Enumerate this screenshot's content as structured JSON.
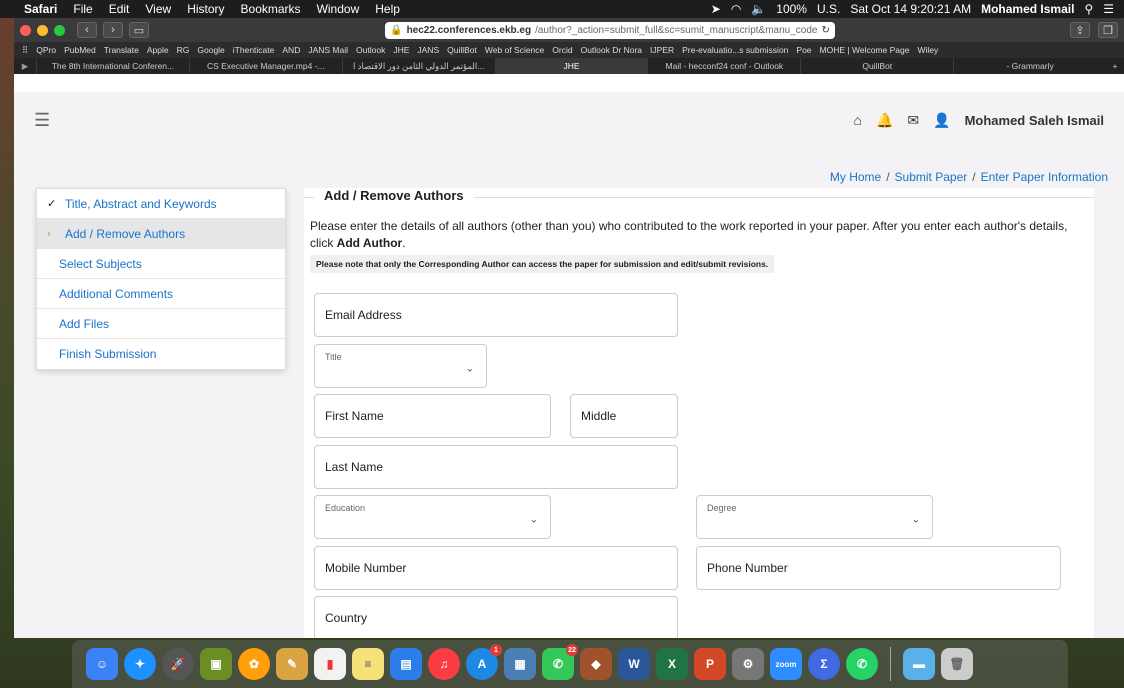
{
  "menubar": {
    "app": "Safari",
    "items": [
      "File",
      "Edit",
      "View",
      "History",
      "Bookmarks",
      "Window",
      "Help"
    ],
    "battery": "100%",
    "input_source": "U.S.",
    "datetime": "Sat Oct 14  9:20:21 AM",
    "user": "Mohamed Ismail"
  },
  "browser": {
    "url_host": "hec22.conferences.ekb.eg",
    "url_path": "/author?_action=submit_full&sc=sumit_manuscript&manu_code",
    "bookmarks": [
      "QPro",
      "PubMed",
      "Translate",
      "Apple",
      "RG",
      "Google",
      "iThenticate",
      "AND",
      "JANS Mail",
      "Outlook",
      "JHE",
      "JANS",
      "QuillBot",
      "Web of Science",
      "Orcid",
      "Outlook Dr Nora",
      "IJPER",
      "Pre-evaluatio...s submission",
      "Poe",
      "MOHE | Welcome Page",
      "Wiley"
    ],
    "tabs": [
      "The 8th International Conferen...",
      "CS Executive Manager.mp4 -...",
      "المؤتمر الدولي الثامن دور الاقتصاد ا...",
      "JHE",
      "Mail - hecconf24 conf - Outlook",
      "QuillBot",
      "- Grammarly"
    ]
  },
  "nav": {
    "username": "Mohamed Saleh Ismail"
  },
  "breadcrumb": {
    "home": "My Home",
    "submit": "Submit Paper",
    "current": "Enter Paper Information"
  },
  "steps": [
    {
      "label": "Title, Abstract and Keywords",
      "state": "done"
    },
    {
      "label": "Add / Remove Authors",
      "state": "active"
    },
    {
      "label": "Select Subjects",
      "state": "pending"
    },
    {
      "label": "Additional Comments",
      "state": "pending"
    },
    {
      "label": "Add Files",
      "state": "pending"
    },
    {
      "label": "Finish Submission",
      "state": "pending"
    }
  ],
  "form": {
    "legend": "Add / Remove Authors",
    "intro_text": "Please enter the details of all authors (other than you) who contributed to the work reported in your paper. After you enter each author's details, click ",
    "intro_bold": "Add Author",
    "intro_end": ".",
    "note": "Please note that only the Corresponding Author can access the paper for submission and edit/submit revisions.",
    "email": "Email Address",
    "title": "Title",
    "first_name": "First Name",
    "middle": "Middle",
    "last_name": "Last Name",
    "education": "Education",
    "degree": "Degree",
    "mobile": "Mobile Number",
    "phone": "Phone Number",
    "country": "Country"
  },
  "dock": {
    "zoom_label": "zoom",
    "badges": [
      "1",
      "22"
    ]
  }
}
